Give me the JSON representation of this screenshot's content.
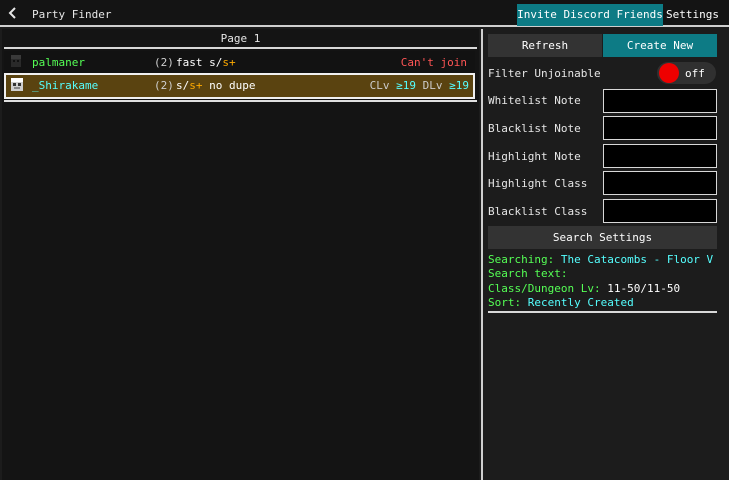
{
  "header": {
    "title": "Party Finder",
    "invite_button": "Invite Discord Friends",
    "settings_button": "Settings"
  },
  "party_list": {
    "page_label": "Page 1",
    "rows": [
      {
        "leader": "palmaner",
        "size": "(2)",
        "note_parts": [
          "fast s/",
          "s+"
        ],
        "status": "Can't join",
        "colors": {
          "leader": "#55ff55",
          "note": "#ffffff",
          "note_accent": "#ffaa00",
          "status": "#ff5555"
        }
      },
      {
        "leader": "_Shirakame",
        "size": "(2)",
        "note_parts": [
          "s/",
          "s+",
          " no dupe"
        ],
        "class_level_label": "CLv",
        "class_level": "≥19",
        "dungeon_level_label": "DLv",
        "dungeon_level": "≥19",
        "colors": {
          "leader": "#55ffff",
          "note": "#ffffff",
          "note_accent": "#ffaa00",
          "level_label": "#cccccc",
          "level_value": "#55ffff"
        }
      }
    ]
  },
  "sidebar": {
    "refresh_button": "Refresh",
    "create_button": "Create New",
    "filter_unjoinable_label": "Filter Unjoinable",
    "filter_unjoinable_state": "off",
    "fields": [
      {
        "label": "Whitelist Note",
        "value": ""
      },
      {
        "label": "Blacklist Note",
        "value": ""
      },
      {
        "label": "Highlight Note",
        "value": ""
      },
      {
        "label": "Highlight Class",
        "value": ""
      },
      {
        "label": "Blacklist Class",
        "value": ""
      }
    ],
    "search_settings_button": "Search Settings",
    "searching_label": "Searching:",
    "searching_value": "The Catacombs - Floor V",
    "search_text_label": "Search text:",
    "search_text_value": "",
    "class_dungeon_label": "Class/Dungeon Lv:",
    "class_dungeon_value": "11-50/11-50",
    "sort_label": "Sort:",
    "sort_value": "Recently Created"
  },
  "colors": {
    "accent": "#0d7b85",
    "toggle_off": "#ee0000",
    "info_label": "#55ff55",
    "info_value": "#55ffff",
    "selected_row": "#5a4310"
  },
  "icons": {
    "back": "chevron-left-icon",
    "party_member": "player-head-icon"
  }
}
